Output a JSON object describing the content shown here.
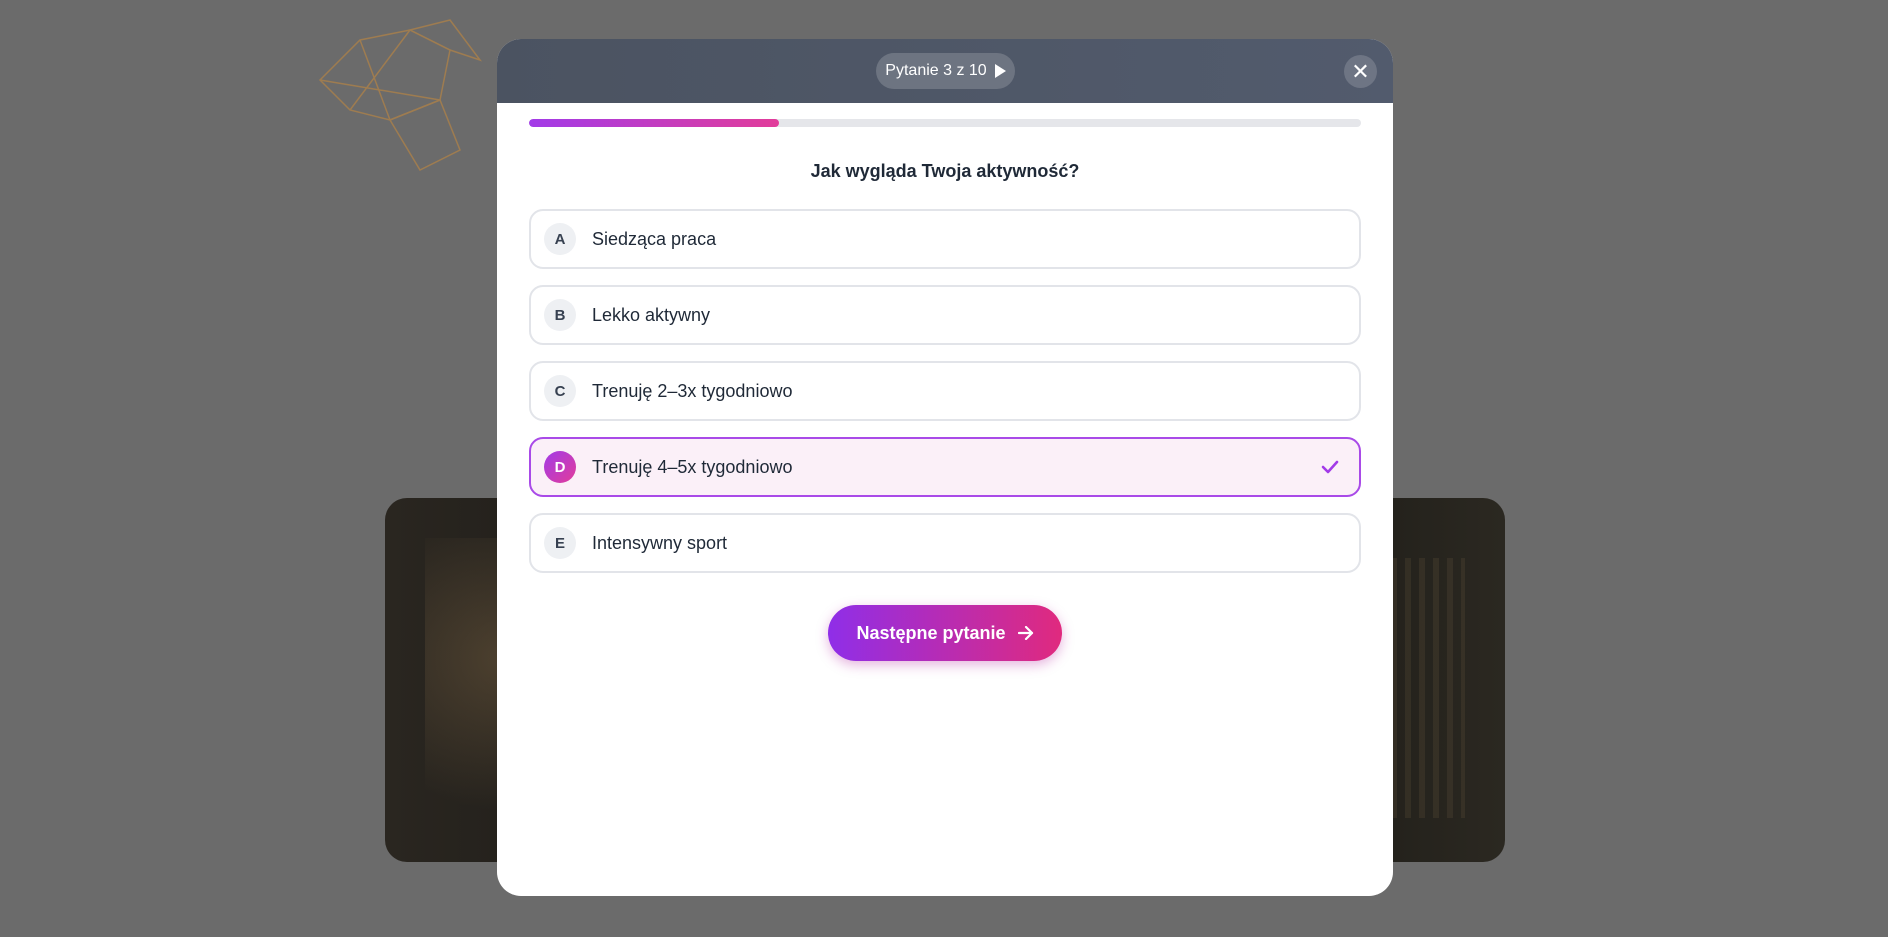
{
  "header": {
    "counter": "Pytanie 3 z 10",
    "close_symbol": "✕"
  },
  "progress": {
    "percent": 30
  },
  "question": "Jak wygląda Twoja aktywność?",
  "options": [
    {
      "letter": "A",
      "label": "Siedząca praca",
      "selected": false
    },
    {
      "letter": "B",
      "label": "Lekko aktywny",
      "selected": false
    },
    {
      "letter": "C",
      "label": "Trenuję 2–3x tygodniowo",
      "selected": false
    },
    {
      "letter": "D",
      "label": "Trenuję 4–5x tygodniowo",
      "selected": true
    },
    {
      "letter": "E",
      "label": "Intensywny sport",
      "selected": false
    }
  ],
  "next_button": {
    "label": "Następne pytanie"
  },
  "colors": {
    "accent_start": "#a23be8",
    "accent_end": "#e23c9a",
    "header_bg": "#4b5361"
  },
  "icons": {
    "counter": "play-icon",
    "close": "close-icon",
    "selected": "check-icon",
    "next": "arrow-right-icon"
  }
}
